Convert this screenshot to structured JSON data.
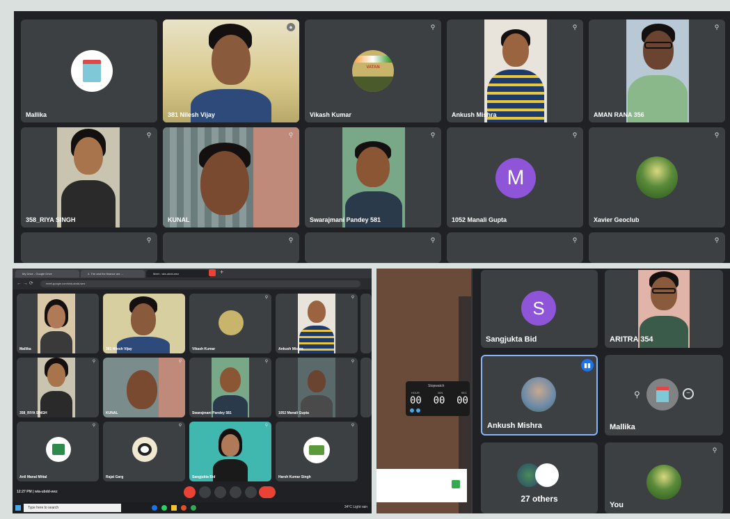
{
  "top_grid": {
    "tiles": [
      {
        "name": "Mallika"
      },
      {
        "name": "381 Nilesh Vijay"
      },
      {
        "name": "Vikash Kumar"
      },
      {
        "name": "Ankush Mishra"
      },
      {
        "name": "AMAN RANA 356"
      },
      {
        "name": "358_RIYA SINGH"
      },
      {
        "name": "KUNAL"
      },
      {
        "name": "Swarajmani Pandey 581"
      },
      {
        "name": "1052 Manali Gupta",
        "initial": "M",
        "avatar_color": "#8e55d8"
      },
      {
        "name": "Xavier Geoclub"
      }
    ],
    "logo_text": "VATAN"
  },
  "browser": {
    "tabs": [
      "My Drive - Google Drive",
      "4. The and the finance are ...",
      "Meet - wia-ubdd-wez"
    ],
    "url": "meet.google.com/wia-ubdd-wez",
    "tiles": [
      {
        "name": "Mallika"
      },
      {
        "name": "381 Nilesh Vijay"
      },
      {
        "name": "Vikash Kumar"
      },
      {
        "name": "Ankush Mishra"
      },
      {
        "name": "358_RIYA SINGH"
      },
      {
        "name": "KUNAL"
      },
      {
        "name": "Swarajmani Pandey 581"
      },
      {
        "name": "1052 Manali Gupta"
      },
      {
        "name": "Anil Manal Mittal"
      },
      {
        "name": "Rajat Garg"
      },
      {
        "name": "Sangjukta Bid"
      },
      {
        "name": "Harsh Kumar Singh"
      }
    ],
    "meeting_time": "12:27 PM",
    "meeting_code": "wia-ubdd-wez",
    "search_placeholder": "Type here to search",
    "weather": "34°C Light rain"
  },
  "right_panel": {
    "tiles": [
      {
        "name": "Sangjukta Bid",
        "initial": "S",
        "avatar_color": "#8e55d8"
      },
      {
        "name": "ARITRA 354"
      },
      {
        "name": "Ankush Mishra"
      },
      {
        "name": "Mallika"
      },
      {
        "name": "27 others"
      },
      {
        "name": "You"
      }
    ],
    "stopwatch": {
      "title": "Stopwatch",
      "labels": [
        "HOUR",
        "MIN",
        "SEC"
      ],
      "values": [
        "00",
        "00",
        "00"
      ]
    }
  },
  "colors": {
    "tile": "#3c4043",
    "background": "#202124",
    "accent": "#1a73e8",
    "end_call": "#ea4335"
  }
}
